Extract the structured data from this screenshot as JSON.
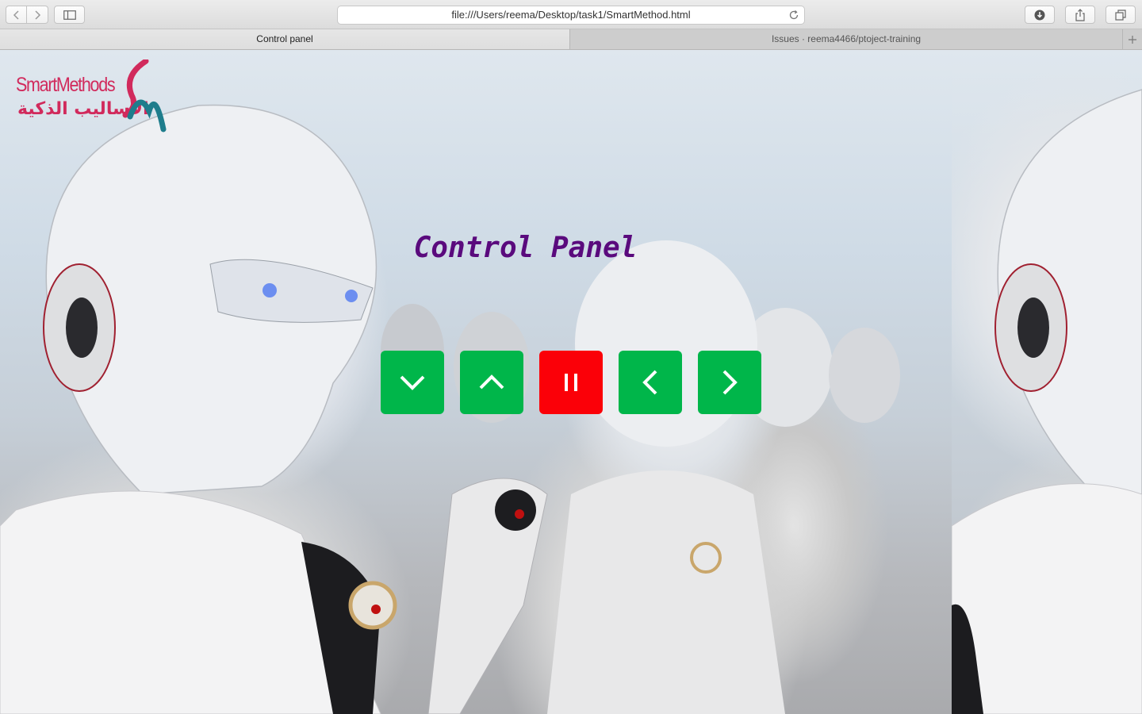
{
  "browser": {
    "url": "file:///Users/reema/Desktop/task1/SmartMethod.html",
    "tabs": [
      {
        "label": "Control panel",
        "active": true
      },
      {
        "label": "Issues · reema4466/ptoject-training",
        "active": false
      }
    ]
  },
  "logo": {
    "english": "SmartMethods",
    "arabic": "الأساليب الذكية",
    "brand_color": "#d12a5c",
    "accent_color": "#1e7d8c"
  },
  "page": {
    "title": "Control Panel",
    "title_color": "#5a0a7d"
  },
  "controls": [
    {
      "name": "down",
      "icon": "chevron-down-icon",
      "color": "#00b64a"
    },
    {
      "name": "up",
      "icon": "chevron-up-icon",
      "color": "#00b64a"
    },
    {
      "name": "pause",
      "icon": "pause-icon",
      "color": "#fb0008"
    },
    {
      "name": "left",
      "icon": "chevron-left-icon",
      "color": "#00b64a"
    },
    {
      "name": "right",
      "icon": "chevron-right-icon",
      "color": "#00b64a"
    }
  ]
}
